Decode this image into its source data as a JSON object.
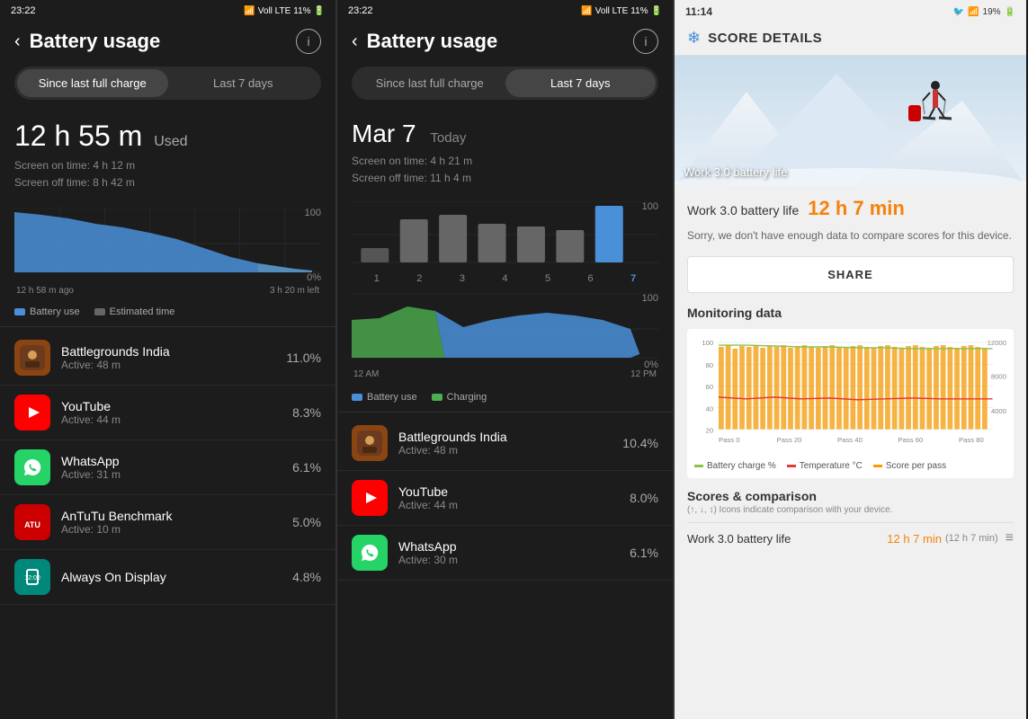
{
  "left_screen": {
    "status_bar": {
      "time": "23:22",
      "battery_percent": "11%",
      "icons": "notifications, wifi, signal"
    },
    "title": "Battery usage",
    "back_label": "‹",
    "info_label": "ⓘ",
    "tab_since": "Since last full charge",
    "tab_last7": "Last 7 days",
    "active_tab": "since",
    "usage_hours": "12 h 55 m",
    "usage_label": "Used",
    "screen_on": "Screen on time: 4 h 12 m",
    "screen_off": "Screen off time: 8 h 42 m",
    "chart_100": "100",
    "chart_0": "0%",
    "time_left_label": "12 h 58 m ago",
    "time_right_label": "3 h 20 m left",
    "legend_battery": "Battery use",
    "legend_estimated": "Estimated time",
    "apps": [
      {
        "name": "Battlegrounds India",
        "active": "Active: 48 m",
        "percent": "11.0%",
        "icon": "bgmi"
      },
      {
        "name": "YouTube",
        "active": "Active: 44 m",
        "percent": "8.3%",
        "icon": "youtube"
      },
      {
        "name": "WhatsApp",
        "active": "Active: 31 m",
        "percent": "6.1%",
        "icon": "whatsapp"
      },
      {
        "name": "AnTuTu Benchmark",
        "active": "Active: 10 m",
        "percent": "5.0%",
        "icon": "antutu"
      },
      {
        "name": "Always On Display",
        "active": "",
        "percent": "4.8%",
        "icon": "aod"
      }
    ]
  },
  "mid_screen": {
    "status_bar": {
      "time": "23:22",
      "battery_percent": "11%"
    },
    "title": "Battery usage",
    "tab_since": "Since last full charge",
    "tab_last7": "Last 7 days",
    "active_tab": "last7",
    "date": "Mar 7",
    "today": "Today",
    "screen_on": "Screen on time: 4 h 21 m",
    "screen_off": "Screen off time: 11 h 4 m",
    "bar_labels": [
      "1",
      "2",
      "3",
      "4",
      "5",
      "6",
      "7"
    ],
    "chart_100": "100",
    "chart_0": "0%",
    "legend_battery": "Battery use",
    "legend_charging": "Charging",
    "time_left": "12 AM",
    "time_right": "12 PM",
    "apps": [
      {
        "name": "Battlegrounds India",
        "active": "Active: 48 m",
        "percent": "10.4%",
        "icon": "bgmi"
      },
      {
        "name": "YouTube",
        "active": "Active: 44 m",
        "percent": "8.0%",
        "icon": "youtube"
      },
      {
        "name": "WhatsApp",
        "active": "Active: 30 m",
        "percent": "6.1%",
        "icon": "whatsapp"
      }
    ]
  },
  "right_screen": {
    "status_bar": {
      "time": "11:14",
      "battery_percent": "19%"
    },
    "header_title": "SCORE DETAILS",
    "hero_label": "Work 3.0 battery life",
    "score_label": "Work 3.0 battery life",
    "score_value": "12 h 7 min",
    "score_desc": "Sorry, we don't have enough data to compare scores for this device.",
    "share_label": "SHARE",
    "monitoring_title": "Monitoring data",
    "legend_charge": "Battery charge %",
    "legend_temp": "Temperature °C",
    "legend_score": "Score per pass",
    "scores_title": "Scores & comparison",
    "scores_sub": "(↑, ↓, ↕) Icons indicate comparison with your device.",
    "scores_row_label": "Work 3.0 battery life",
    "scores_row_value": "12 h 7 min",
    "scores_row_sub": "(12 h 7 min)",
    "chart_y_100": "100",
    "chart_y_80": "80",
    "chart_y_60": "60",
    "chart_y_40": "40",
    "chart_y_20": "20",
    "chart_y_12000": "12000",
    "chart_y_8000": "8000",
    "chart_y_4000": "4000",
    "pass_labels": [
      "Pass 0",
      "Pass 20",
      "Pass 40",
      "Pass 60",
      "Pass 80"
    ]
  }
}
